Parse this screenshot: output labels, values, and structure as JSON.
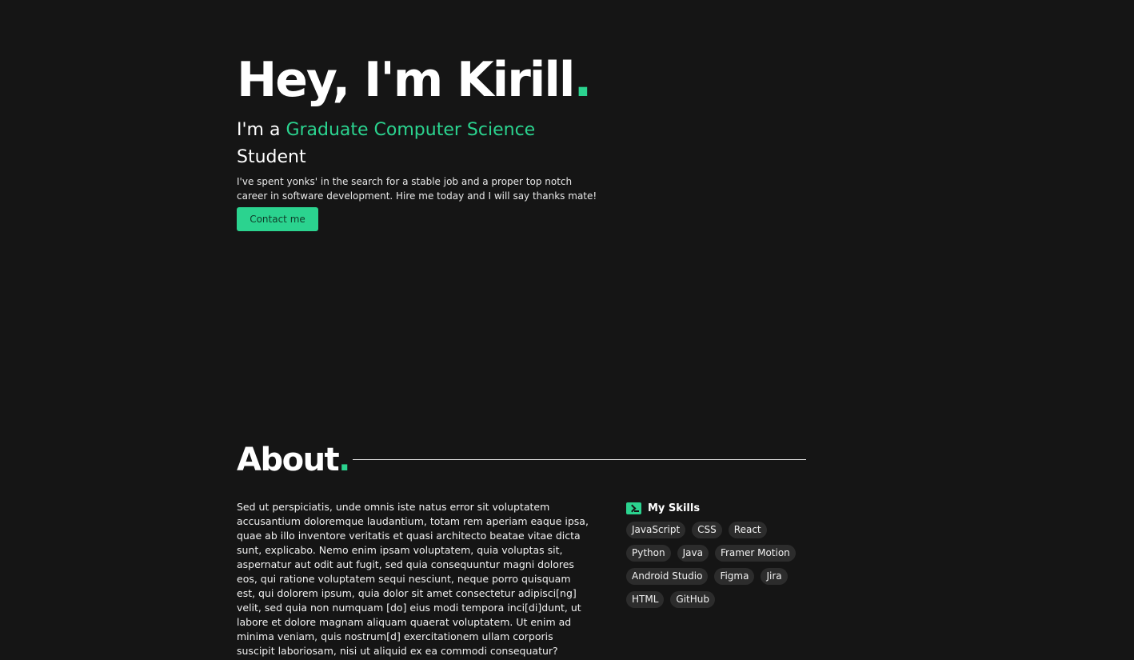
{
  "hero": {
    "name_prefix": "Hey, I'm Kirill",
    "name_dot": ".",
    "subtitle_prefix": "I'm a ",
    "subtitle_highlight": "Graduate Computer Science",
    "subtitle_suffix": "Student",
    "description": "I've spent yonks' in the search for a stable job and a proper top notch career in software development. Hire me today and I will say thanks mate!",
    "contact_label": "Contact me"
  },
  "about": {
    "title": "About",
    "title_dot": ".",
    "body": "Sed ut perspiciatis, unde omnis iste natus error sit voluptatem accusantium doloremque laudantium, totam rem aperiam eaque ipsa, quae ab illo inventore veritatis et quasi architecto beatae vitae dicta sunt, explicabo. Nemo enim ipsam voluptatem, quia voluptas sit, aspernatur aut odit aut fugit, sed quia consequuntur magni dolores eos, qui ratione voluptatem sequi nesciunt, neque porro quisquam est, qui dolorem ipsum, quia dolor sit amet consectetur adipisci[ng] velit, sed quia non numquam [do] eius modi tempora inci[di]dunt, ut labore et dolore magnam aliquam quaerat voluptatem. Ut enim ad minima veniam, quis nostrum[d] exercitationem ullam corporis suscipit laboriosam, nisi ut aliquid ex ea commodi consequatur?"
  },
  "skills": {
    "title": "My Skills",
    "icon": "terminal-icon",
    "items": [
      "JavaScript",
      "CSS",
      "React",
      "Python",
      "Java",
      "Framer Motion",
      "Android Studio",
      "Figma",
      "Jira",
      "HTML",
      "GitHub"
    ]
  },
  "colors": {
    "background": "#151515",
    "accent": "#2bd38f",
    "chip_bg": "#2c2c2c"
  }
}
